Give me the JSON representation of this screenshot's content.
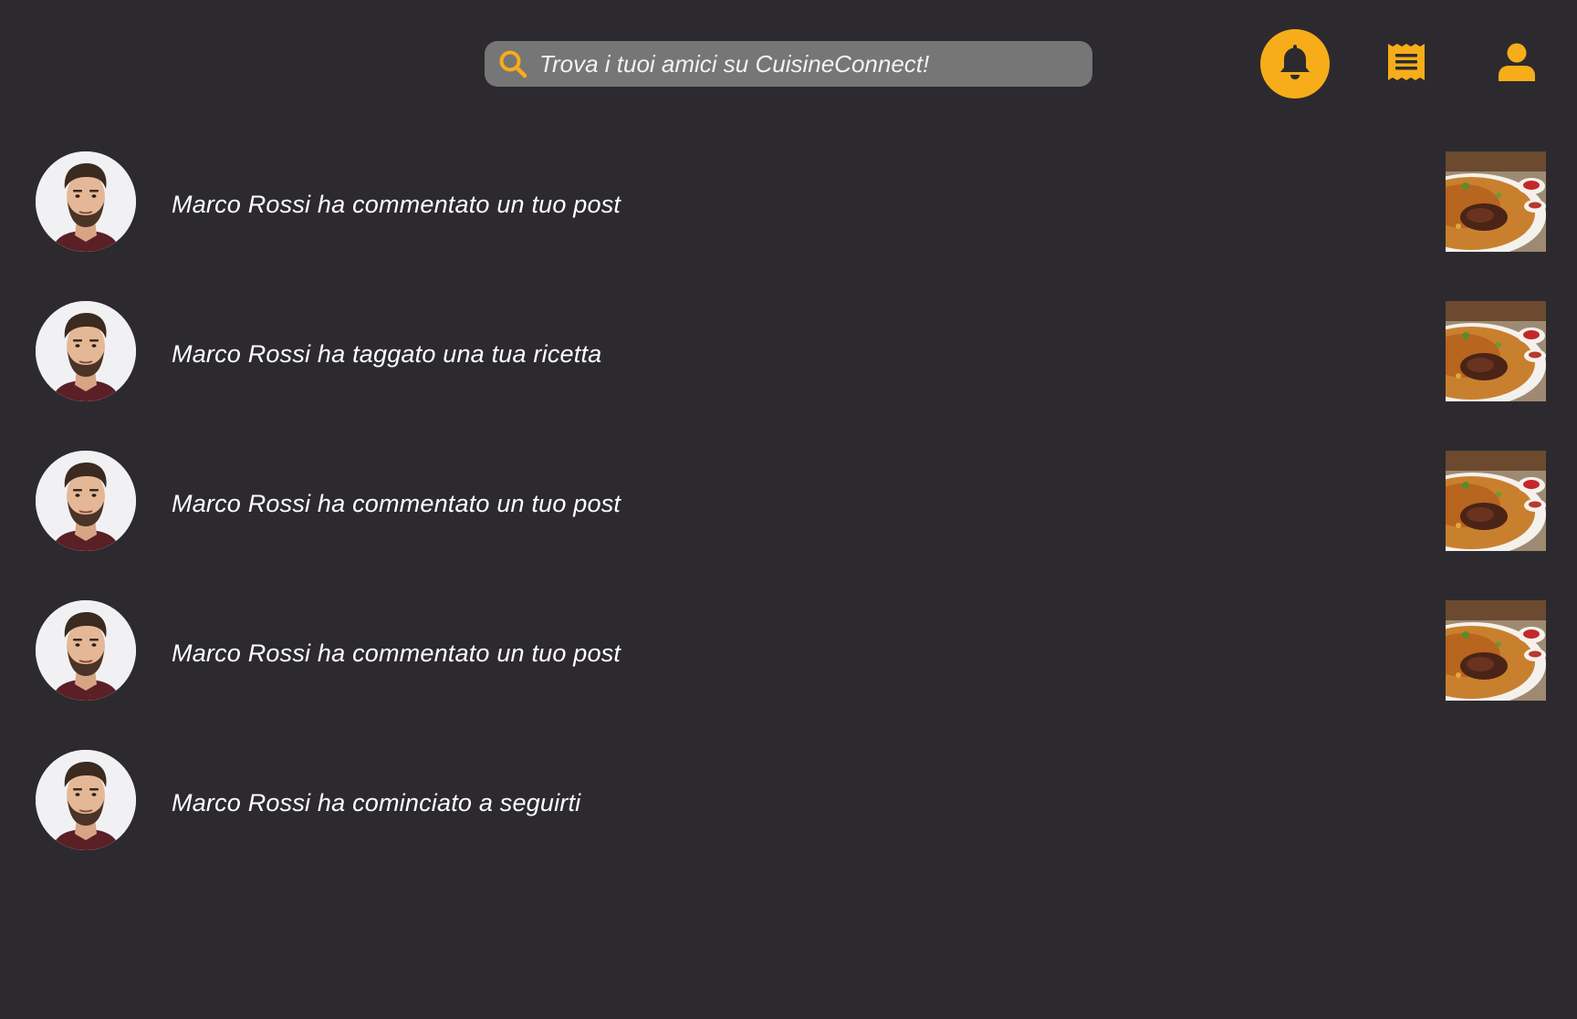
{
  "search": {
    "placeholder": "Trova i tuoi amici su CuisineConnect!"
  },
  "nav": {
    "items": [
      {
        "name": "notifications",
        "icon": "bell-icon",
        "active": true
      },
      {
        "name": "feed",
        "icon": "receipt-icon",
        "active": false
      },
      {
        "name": "profile",
        "icon": "user-icon",
        "active": false
      }
    ]
  },
  "colors": {
    "background": "#2c2a2e",
    "accent": "#f7ad19",
    "search_bg": "#767676",
    "text": "#ffffff"
  },
  "notifications": [
    {
      "text": "Marco Rossi ha commentato un tuo post",
      "has_thumbnail": true
    },
    {
      "text": "Marco Rossi ha taggato una tua ricetta",
      "has_thumbnail": true
    },
    {
      "text": "Marco Rossi ha commentato un tuo post",
      "has_thumbnail": true
    },
    {
      "text": "Marco Rossi ha commentato un tuo post",
      "has_thumbnail": true
    },
    {
      "text": "Marco Rossi ha cominciato a seguirti",
      "has_thumbnail": false
    }
  ]
}
